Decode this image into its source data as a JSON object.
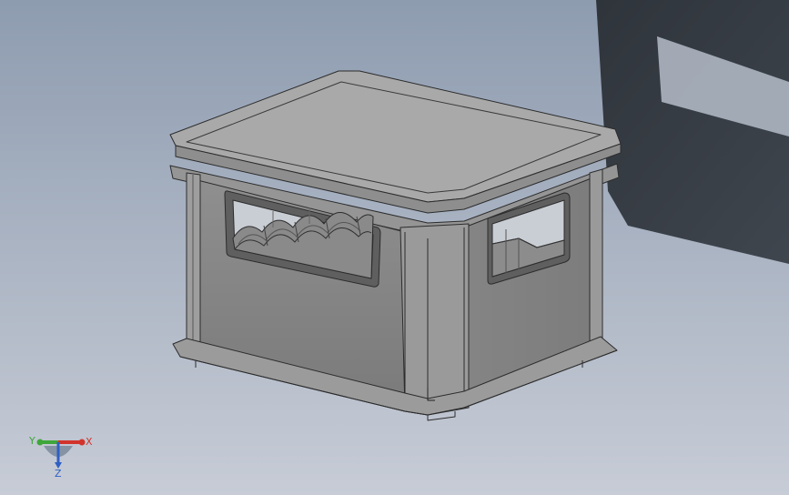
{
  "viewport": {
    "background_top": "#8e9cb0",
    "background_bottom": "#c7ccd6",
    "model": "crate",
    "shadow_color": "#2e3338"
  },
  "triad": {
    "x_label": "X",
    "y_label": "Y",
    "z_label": "Z",
    "x_color": "#d2342c",
    "y_color": "#3fa63a",
    "z_color": "#2f5fc4"
  }
}
